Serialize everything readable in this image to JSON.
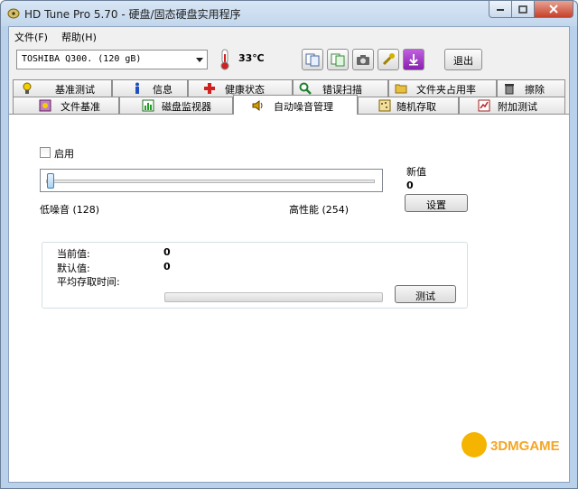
{
  "window": {
    "title": "HD Tune Pro 5.70 - 硬盘/固态硬盘实用程序"
  },
  "menu": {
    "file": "文件(F)",
    "help": "帮助(H)"
  },
  "toolbar": {
    "drive": "TOSHIBA Q300. (120 gB)",
    "temperature": "33℃",
    "exit_label": "退出",
    "buttons": [
      "copy-info-icon",
      "copy-screen-icon",
      "camera-icon",
      "options-icon",
      "save-icon"
    ]
  },
  "tabs": {
    "row_top": [
      "基准测试",
      "信息",
      "健康状态",
      "错误扫描",
      "文件夹占用率",
      "擦除"
    ],
    "row_bottom": [
      "文件基准",
      "磁盘监视器",
      "自动噪音管理",
      "随机存取",
      "附加测试"
    ],
    "active": "自动噪音管理"
  },
  "aam": {
    "enable_label": "启用",
    "enabled": false,
    "slider_position": 0,
    "low_label": "低噪音 (128)",
    "high_label": "高性能 (254)",
    "new_value_label": "新值",
    "new_value": "0",
    "set_button": "设置",
    "current_label": "当前值:",
    "current_value": "0",
    "default_label": "默认值:",
    "default_value": "0",
    "avg_access_label": "平均存取时间:",
    "test_button": "测试"
  },
  "watermark": {
    "text": "3DMGAME"
  },
  "colors": {
    "frame": "#b9d1ea",
    "close_button": "#c7402a",
    "watermark": "#f5a623"
  }
}
